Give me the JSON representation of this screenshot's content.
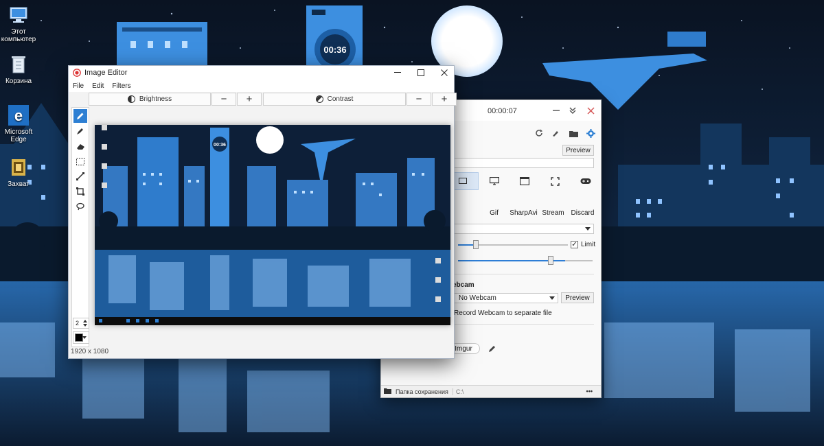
{
  "desktop": {
    "icons": [
      {
        "label": "Этот\nкомпьютер",
        "icon": "computer-icon"
      },
      {
        "label": "Корзина",
        "icon": "recycle-bin-icon"
      },
      {
        "label": "Microsoft\nEdge",
        "icon": "edge-icon"
      },
      {
        "label": "Захват",
        "icon": "capture-app-icon"
      }
    ],
    "wallpaper_clock": "00:36"
  },
  "editor": {
    "title": "Image Editor",
    "menu": [
      "File",
      "Edit",
      "Filters"
    ],
    "brightness_label": "Brightness",
    "contrast_label": "Contrast",
    "minus": "−",
    "plus": "+",
    "brush_size": "2",
    "image_size": "1920 x 1080",
    "canvas_clock": "00:36"
  },
  "recorder": {
    "timer": "00:00:07",
    "preview_label": "Preview",
    "formats": [
      "Gif",
      "SharpAvi",
      "Stream",
      "Discard"
    ],
    "limit_label": "Limit",
    "webcam_section": "ebcam",
    "webcam_value": "No Webcam",
    "webcam_preview": "Preview",
    "separate_file_label": "Record Webcam to separate file",
    "imgur_label": "Imgur",
    "save_folder_label": "Папка сохранения",
    "save_path": "C:\\",
    "more_label": "•••"
  },
  "colors": {
    "accent": "#2d7fd3",
    "wallpaper_blue": "#3d8fe0",
    "night_sky": "#0b1626"
  }
}
